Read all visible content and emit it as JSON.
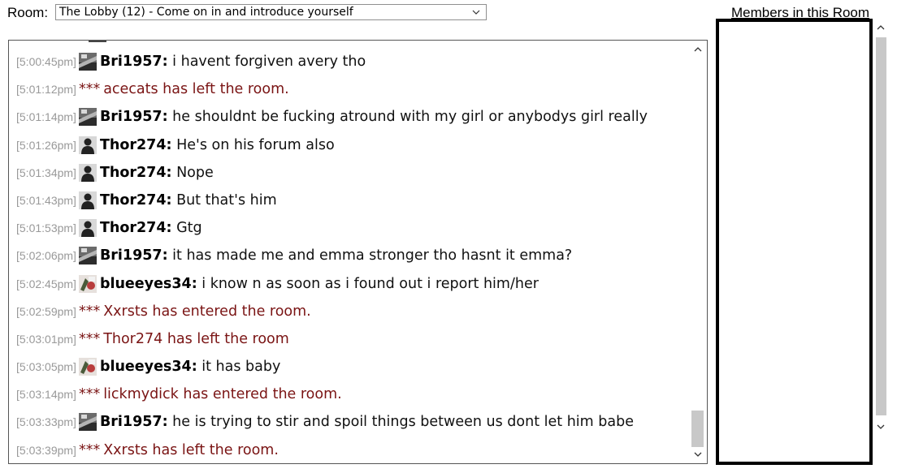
{
  "room": {
    "label": "Room:",
    "selected": "The Lobby (12) - Come on in and introduce yourself",
    "chevron_icon": "chevron-down-icon"
  },
  "chat": {
    "messages": [
      {
        "time": "[5:00:45pm]",
        "type": "user",
        "user": "Bri1957:",
        "text": "i havent forgiven avery tho",
        "avatar": "avatar-bri"
      },
      {
        "time": "[5:01:12pm]",
        "type": "system",
        "stars": "***",
        "text": "acecats has left the room."
      },
      {
        "time": "[5:01:14pm]",
        "type": "user",
        "user": "Bri1957:",
        "text": "he shouldnt be fucking atround with my girl or anybodys girl really",
        "avatar": "avatar-bri"
      },
      {
        "time": "[5:01:26pm]",
        "type": "user",
        "user": "Thor274:",
        "text": "He's on his forum also",
        "avatar": "avatar-thor"
      },
      {
        "time": "[5:01:34pm]",
        "type": "user",
        "user": "Thor274:",
        "text": "Nope",
        "avatar": "avatar-thor"
      },
      {
        "time": "[5:01:43pm]",
        "type": "user",
        "user": "Thor274:",
        "text": "But that's him",
        "avatar": "avatar-thor"
      },
      {
        "time": "[5:01:53pm]",
        "type": "user",
        "user": "Thor274:",
        "text": "Gtg",
        "avatar": "avatar-thor"
      },
      {
        "time": "[5:02:06pm]",
        "type": "user",
        "user": "Bri1957:",
        "text": "it has made me and emma stronger tho hasnt it emma?",
        "avatar": "avatar-bri"
      },
      {
        "time": "[5:02:45pm]",
        "type": "user",
        "user": "blueeyes34:",
        "text": "i know n as soon as i found out i report him/her",
        "avatar": "avatar-blue"
      },
      {
        "time": "[5:02:59pm]",
        "type": "system",
        "stars": "***",
        "text": "Xxrsts has entered the room."
      },
      {
        "time": "[5:03:01pm]",
        "type": "system",
        "stars": "***",
        "text": "Thor274 has left the room"
      },
      {
        "time": "[5:03:05pm]",
        "type": "user",
        "user": "blueeyes34:",
        "text": "it has baby",
        "avatar": "avatar-blue"
      },
      {
        "time": "[5:03:14pm]",
        "type": "system",
        "stars": "***",
        "text": "lickmydick has entered the room."
      },
      {
        "time": "[5:03:33pm]",
        "type": "user",
        "user": "Bri1957:",
        "text": "he is trying to stir and spoil things between us dont let him babe",
        "avatar": "avatar-bri"
      },
      {
        "time": "[5:03:39pm]",
        "type": "system",
        "stars": "***",
        "text": "Xxrsts has left the room."
      }
    ],
    "scroll_position_pct": 98
  },
  "members": {
    "title": "Members in this Room",
    "items": []
  },
  "colors": {
    "system_text": "#7a1414",
    "timestamp": "#999999",
    "scrollbar_thumb": "#c8c8c8"
  }
}
